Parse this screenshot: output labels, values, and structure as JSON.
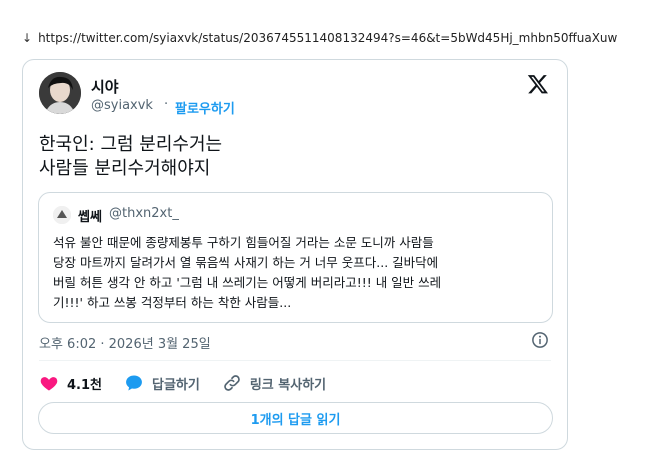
{
  "url": {
    "icon": "download-arrow-icon",
    "text": "https://twitter.com/syiaxvk/status/2036745511408132494?s=46&t=5bWd45Hj_mhbn50ffuaXuw"
  },
  "tweet": {
    "author_name": "시야",
    "author_handle": "@syiaxvk",
    "separator": "·",
    "follow_label": "팔로우하기",
    "text_lines": [
      "한국인: 그럼 분리수거는",
      "사람들 분리수거해야지"
    ],
    "quote": {
      "name": "쎕쎄",
      "handle": "@thxn2xt_",
      "text_lines": [
        "석유 불안 때문에 종량제봉투 구하기 힘들어질 거라는 소문 도니까 사람들",
        "당장 마트까지 달려가서 열 묶음씩 사재기 하는 거 너무 웃프다... 길바닥에",
        "버릴 허튼 생각 안 하고 '그럼 내 쓰레기는 어떻게 버리라고!!! 내 일반 쓰레",
        "기!!!' 하고 쓰봉 걱정부터 하는 착한 사람들..."
      ]
    },
    "timestamp": "오후 6:02 · 2026년 3월 25일",
    "actions": {
      "like_count": "4.1천",
      "reply_label": "답글하기",
      "copy_link_label": "링크 복사하기"
    },
    "read_replies_label": "1개의 답글 읽기"
  },
  "colors": {
    "accent": "#1d9bf0",
    "like": "#f91880",
    "muted": "#536471",
    "border": "#cfd9de"
  }
}
